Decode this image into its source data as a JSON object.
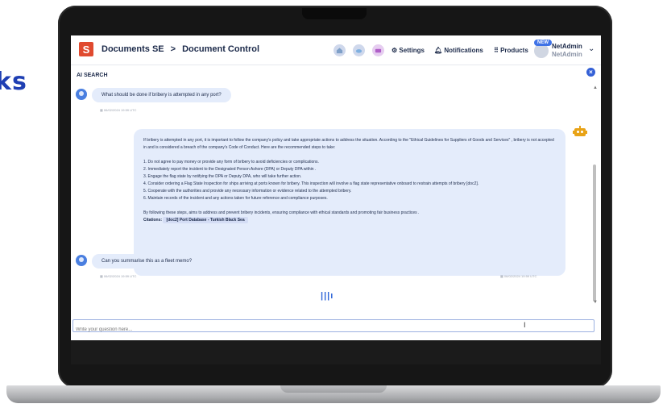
{
  "background_text": "ks",
  "header": {
    "logo_letter": "S",
    "app_name": "Documents SE",
    "separator": ">",
    "section": "Document Control",
    "settings_label": "Settings",
    "notifications_label": "Notifications",
    "products_label": "Products",
    "new_badge": "NEW",
    "user_name_line1": "NetAdmin",
    "user_name_line2": "NetAdmin"
  },
  "panel": {
    "title": "AI SEARCH",
    "close_glyph": "×"
  },
  "messages": {
    "q1": "What should be done if bribery is attempted in any port?",
    "q1_time": "06/02/2024 19:59 UTC",
    "answer": {
      "intro": "If bribery is attempted in any port, it is important to follow the company's policy and take appropriate actions to address the situation. According to the \"Ethical Guidelines for Suppliers of Goods and Services\" , bribery is not accepted in           and is considered a breach of the company's Code of Conduct. Here are the recommended steps to take:",
      "step1": "1. Do not agree to pay money or provide any form of bribery to avoid deficiencies or complications.",
      "step2": "2. Immediately report the incident to the Designated Person Ashore (DPA) or Deputy DPA within           .",
      "step3": "3. Engage the flag state by notifying the DPA or Deputy DPA, who will take further action.",
      "step4": "4. Consider ordering a Flag State Inspection for ships arriving at ports known for bribery. This inspection will involve a flag state representative onboard to restrain attempts of bribery [doc2].",
      "step5": "5. Cooperate with the authorities and provide any necessary information or evidence related to the attempted bribery.",
      "step6": "6. Maintain records of the incident and any actions taken for future reference and compliance purposes.",
      "closing": "By following these steps,           aims to address and prevent bribery incidents, ensuring compliance with ethical standards and promoting fair business practices .",
      "citations_label": "Citations:",
      "citation": "[doc2] Port Database - Turkish Black Sea"
    },
    "answer_time": "06/02/2024 19:59 UTC",
    "q2": "Can you summarise this as a fleet memo?",
    "q2_time": "06/02/2024 19:59 UTC",
    "loading_glyph": "|||ı"
  },
  "input": {
    "placeholder": "Write your question here..."
  },
  "colors": {
    "accent": "#3460d6",
    "logo": "#e04a2f",
    "bubble": "#e4ecfb",
    "bot_icon": "#e8a317"
  }
}
